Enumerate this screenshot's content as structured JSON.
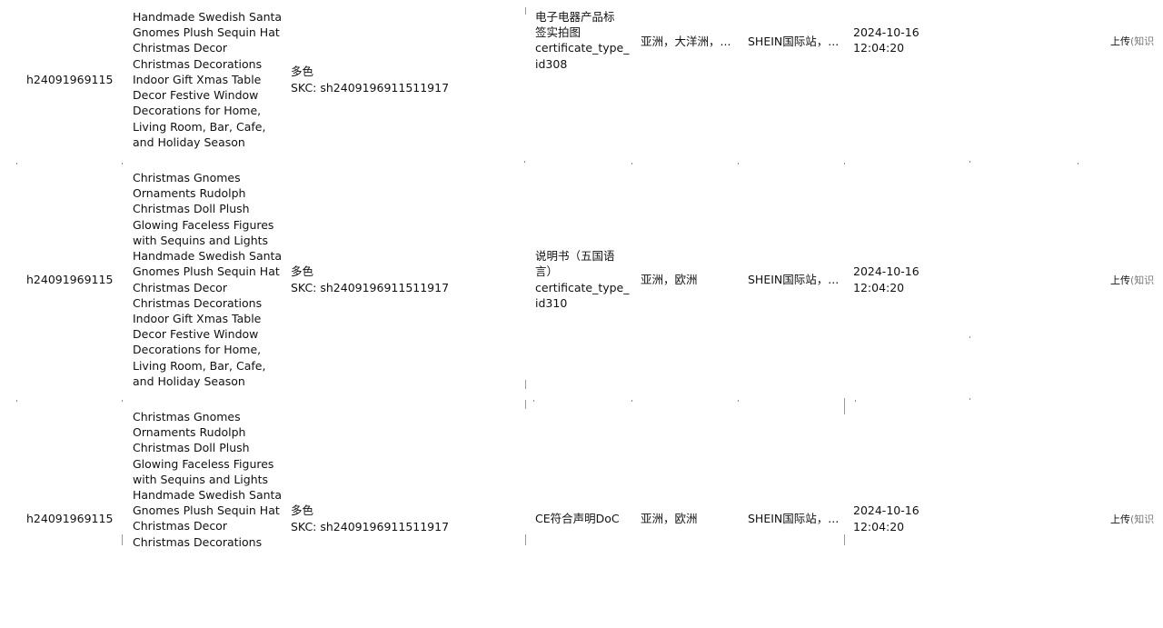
{
  "rows": [
    {
      "id": "h24091969115",
      "name_lines": [
        "Handmade Swedish Santa",
        "Gnomes Plush Sequin Hat",
        "Christmas Decor",
        "Christmas Decorations",
        "Indoor Gift Xmas Table",
        "Decor Festive Window",
        "Decorations for Home,",
        "Living Room, Bar, Cafe,",
        "and Holiday Season"
      ],
      "color": "多色",
      "skc": "SKC:  sh2409196911511917",
      "cert_lines": [
        "电子电器产品标",
        "签实拍图",
        "certificate_type_",
        "id308"
      ],
      "region": "亚洲，大洋洲，...",
      "site": "SHEIN国际站，...",
      "date": "2024-10-16",
      "time": "12:04:20",
      "action": "上传",
      "action_note": "(知识"
    },
    {
      "id": "h24091969115",
      "name_lines": [
        "Christmas Gnomes",
        "Ornaments Rudolph",
        "Christmas Doll Plush",
        "Glowing Faceless Figures",
        "with Sequins and Lights",
        "Handmade Swedish Santa",
        "Gnomes Plush Sequin Hat",
        "Christmas Decor",
        "Christmas Decorations",
        "Indoor Gift Xmas Table",
        "Decor Festive Window",
        "Decorations for Home,",
        "Living Room, Bar, Cafe,",
        "and Holiday Season"
      ],
      "color": "多色",
      "skc": "SKC:  sh2409196911511917",
      "cert_lines": [
        "说明书（五国语",
        "言）",
        "certificate_type_",
        "id310"
      ],
      "region": "亚洲，欧洲",
      "site": "SHEIN国际站，...",
      "date": "2024-10-16",
      "time": "12:04:20",
      "action": "上传",
      "action_note": "(知识"
    },
    {
      "id": "h24091969115",
      "name_lines": [
        "Christmas Gnomes",
        "Ornaments Rudolph",
        "Christmas Doll Plush",
        "Glowing Faceless Figures",
        "with Sequins and Lights",
        "Handmade Swedish Santa",
        "Gnomes Plush Sequin Hat",
        "Christmas Decor",
        "Christmas Decorations"
      ],
      "color": "多色",
      "skc": "SKC:  sh2409196911511917",
      "cert_lines": [
        "CE符合声明DoC"
      ],
      "region": "亚洲，欧洲",
      "site": "SHEIN国际站，...",
      "date": "2024-10-16",
      "time": "12:04:20",
      "action": "上传",
      "action_note": "(知识"
    }
  ]
}
